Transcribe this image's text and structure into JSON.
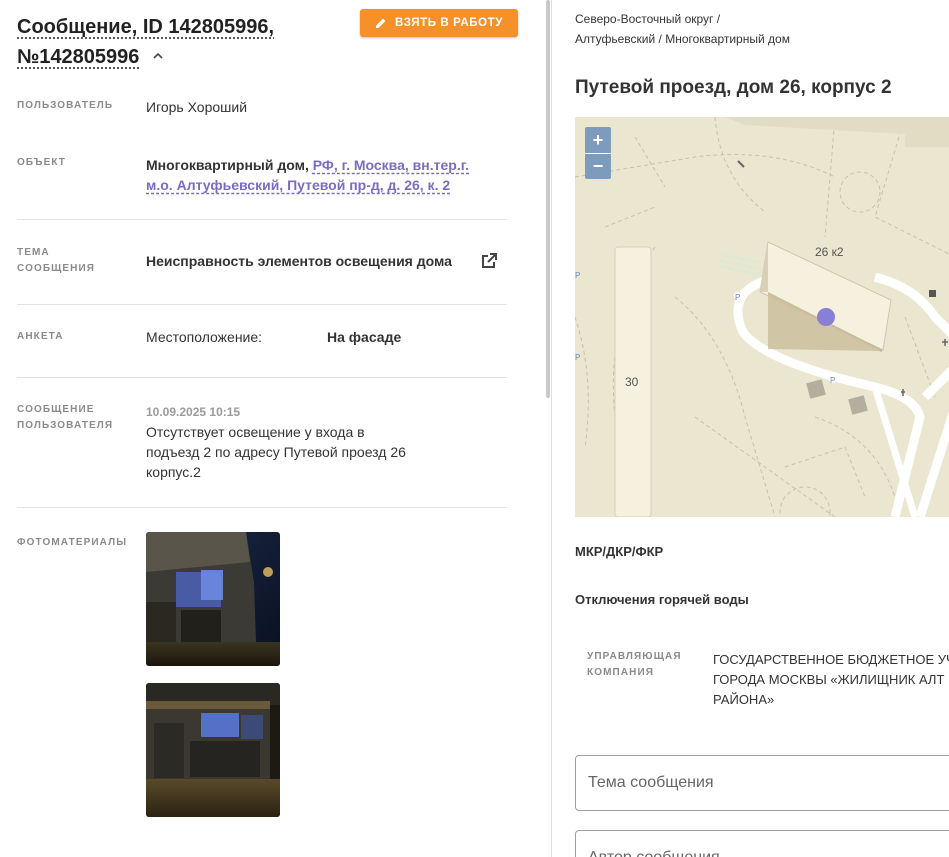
{
  "header": {
    "title": "Сообщение, ID 142805996, №142805996",
    "take_button": "ВЗЯТЬ В РАБОТУ"
  },
  "fields": {
    "user": {
      "label": "ПОЛЬЗОВАТЕЛЬ",
      "value": "Игорь Хороший"
    },
    "object": {
      "label": "ОБЪЕКТ",
      "type": "Многоквартирный дом,",
      "address": "РФ, г. Москва, вн.тер.г. м.о. Алтуфьевский, Путевой пр-д, д. 26, к. 2"
    },
    "topic": {
      "label": "ТЕМА СООБЩЕНИЯ",
      "value": "Неисправность элементов освещения дома"
    },
    "survey": {
      "label": "АНКЕТА",
      "question": "Местоположение:",
      "answer": "На фасаде"
    },
    "message": {
      "label": "СООБЩЕНИЕ ПОЛЬЗОВАТЕЛЯ",
      "date": "10.09.2025 10:15",
      "text": "Отсутствует освещение у входа в подъезд 2 по адресу Путевой проезд 26 корпус.2"
    },
    "photos": {
      "label": "ФОТОМАТЕРИАЛЫ"
    }
  },
  "right": {
    "breadcrumb_line1": "Северо-Восточный округ /",
    "breadcrumb_line2": "Алтуфьевский / Многоквартирный дом",
    "address": "Путевой проезд, дом 26, корпус 2",
    "map": {
      "building_main": "26 к2",
      "building_side": "30",
      "zoom_in": "+",
      "zoom_out": "−",
      "marker_color": "#8a7fd6"
    },
    "section_mkr": "МКР/ДКР/ФКР",
    "section_hot_water": "Отключения горячей воды",
    "management": {
      "label": "УПРАВЛЯЮЩАЯ КОМПАНИЯ",
      "value": "ГОСУДАРСТВЕННОЕ БЮДЖЕТНОЕ УЧ\nГОРОДА МОСКВЫ «ЖИЛИЩНИК АЛТ\nРАЙОНА»"
    },
    "topic_field_placeholder": "Тема сообщения",
    "author_field_placeholder": "Автор сообщения"
  },
  "colors": {
    "accent": "#f5902a",
    "link": "#7b6bc4",
    "label": "#8a8a8a"
  }
}
